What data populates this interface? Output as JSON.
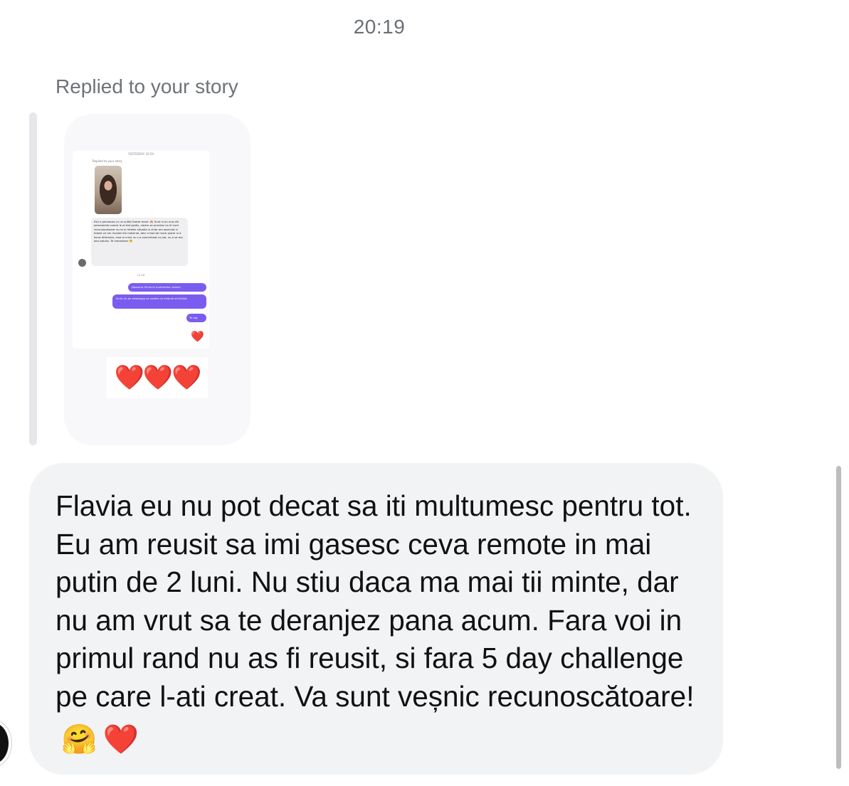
{
  "chat": {
    "timestamp": "20:19",
    "replied_label": "Replied to your story",
    "story": {
      "mini_timestamp": "YESTERDAY 20:59",
      "mini_replied_label": "Replied to your story",
      "mini_incoming_text": "Esti o persoana cu un suflet foarte mare. 🙈 Sunt si eu una din persoanele carora le-ai dat gratis, voiam se punctez ca iti sunt recunoscatoare ca mi ai inteles situatia si chiar am apreciat si folosit ce am invatat din material, deci a fost de mare ajutor si a facut diferenta, insa la mine nu s a concretizat cu job, nu o sa ma dau batuta. Te imbratisez 🤗",
      "mini_time2": "13:18",
      "mini_outgoing": [
        "Doamne Olivia iti multumesc enorm",
        "Scrie mi pe whatsapp sa vedem ce trebuie schimbat",
        "Te rog"
      ],
      "mini_heart": "❤️",
      "reaction_hearts": "❤️❤️❤️"
    },
    "message": {
      "text": "Flavia eu nu pot decat sa iti multumesc pentru tot. Eu am reusit sa imi gasesc ceva remote in mai putin de 2 luni. Nu stiu daca ma mai tii minte, dar nu am vrut sa te deranjez pana acum. Fara voi in primul rand nu as fi reusit, si fara 5 day challenge pe care l-ati creat. Va sunt veșnic recunoscătoare!",
      "emoji_hug": "🤗",
      "emoji_heart": "❤️"
    }
  }
}
